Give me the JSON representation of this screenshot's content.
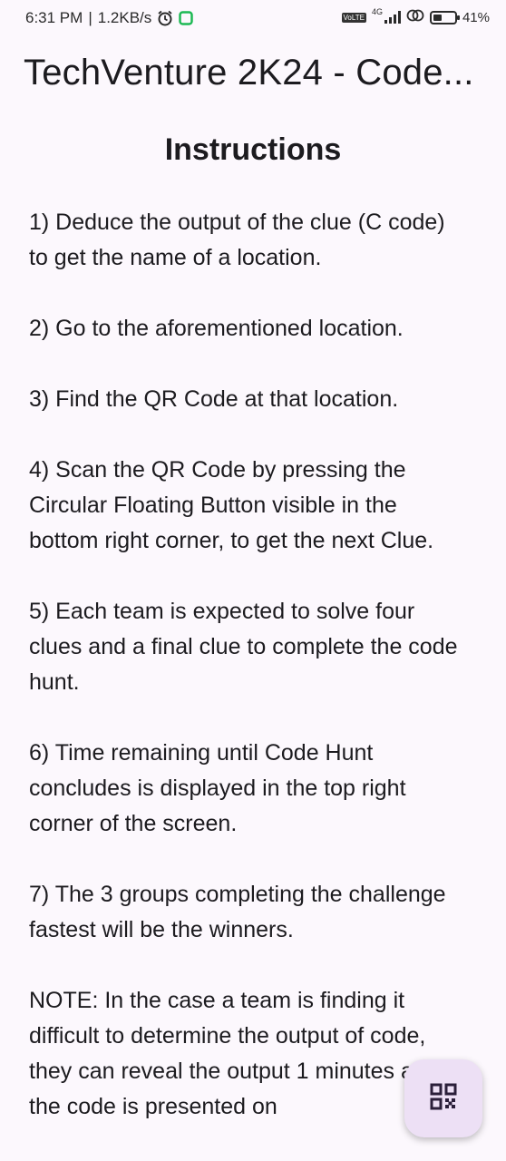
{
  "status_bar": {
    "time": "6:31 PM",
    "separator": "|",
    "speed": "1.2KB/s",
    "network": "4G",
    "lte": "VoLTE",
    "battery": "41%",
    "battery_level": 0.41
  },
  "app_bar": {
    "title": "TechVenture 2K24 - Code..."
  },
  "main": {
    "heading": "Instructions",
    "instructions": [
      "1) Deduce the output of the clue (C code) to get the name of a location.",
      "2) Go to the aforementioned location.",
      "3) Find the QR Code at that location.",
      "4) Scan the QR Code by pressing the Circular Floating Button visible in the bottom right corner, to get the next Clue.",
      "5) Each team is expected to solve four clues and a final clue to complete the code hunt.",
      "6) Time remaining until Code Hunt concludes is displayed in the top right corner of the screen.",
      "7) The 3 groups completing the challenge fastest will be the winners.",
      "NOTE: In the case a team is finding it difficult to determine the output of code, they can reveal the output 1 minutes after the code is presented on"
    ]
  },
  "fab": {
    "icon": "qr-code-icon",
    "color": "#ede0f5"
  }
}
